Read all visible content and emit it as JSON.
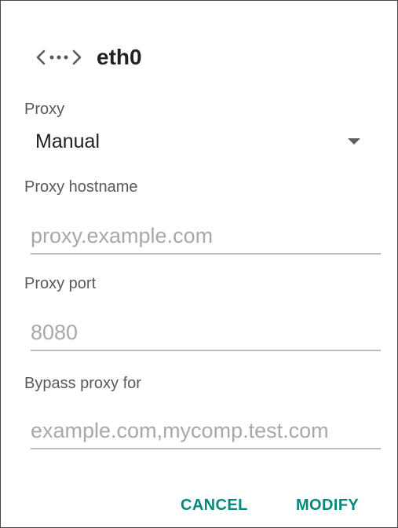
{
  "dialog": {
    "icon": "ethernet-icon",
    "title": "eth0"
  },
  "proxy": {
    "label": "Proxy",
    "selected": "Manual"
  },
  "hostname": {
    "label": "Proxy hostname",
    "value": "",
    "placeholder": "proxy.example.com"
  },
  "port": {
    "label": "Proxy port",
    "value": "",
    "placeholder": "8080"
  },
  "bypass": {
    "label": "Bypass proxy for",
    "value": "",
    "placeholder": "example.com,mycomp.test.com"
  },
  "actions": {
    "cancel": "CANCEL",
    "modify": "MODIFY"
  },
  "colors": {
    "accent": "#00897b",
    "label": "#595959",
    "placeholder": "#a8a8a8",
    "underline": "#bdbdbd"
  }
}
